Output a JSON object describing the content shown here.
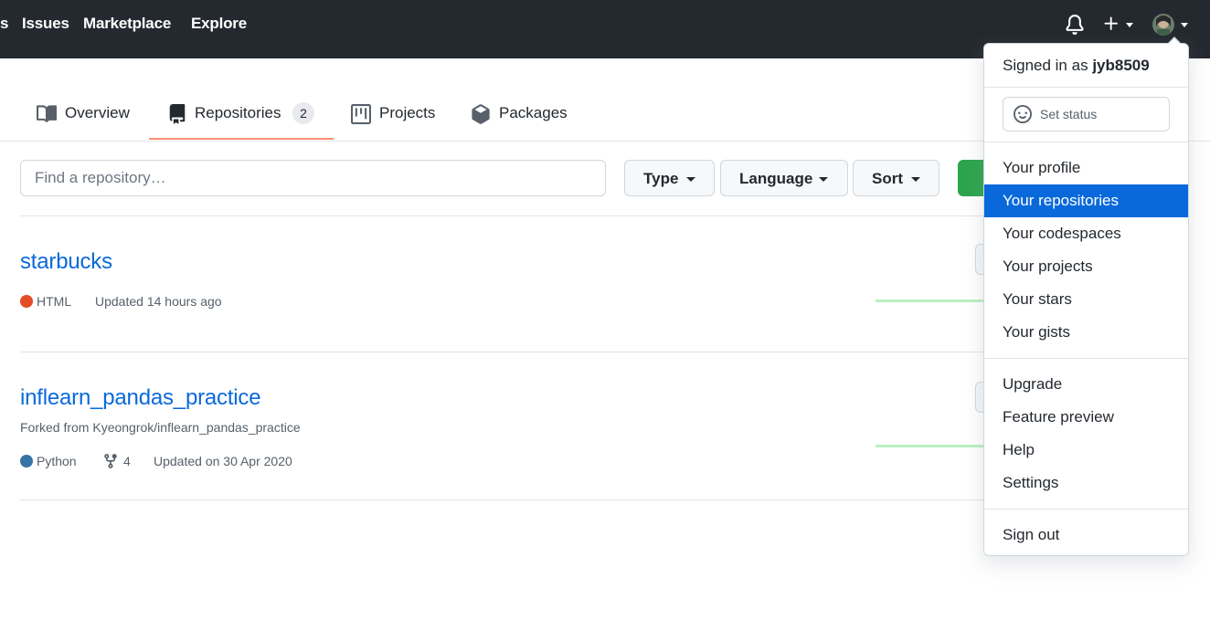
{
  "header": {
    "nav": [
      "s",
      "Issues",
      "Marketplace",
      "Explore"
    ],
    "icons": [
      "bell-icon",
      "plus-icon",
      "avatar"
    ]
  },
  "tabs": [
    {
      "label": "Overview",
      "icon": "book-icon"
    },
    {
      "label": "Repositories",
      "icon": "repo-icon",
      "count": "2",
      "active": true
    },
    {
      "label": "Projects",
      "icon": "project-icon"
    },
    {
      "label": "Packages",
      "icon": "package-icon"
    }
  ],
  "filters": {
    "search_placeholder": "Find a repository…",
    "type_label": "Type",
    "language_label": "Language",
    "sort_label": "Sort"
  },
  "repos": [
    {
      "name": "starbucks",
      "language": "HTML",
      "language_color": "#e34c26",
      "updated": "Updated 14 hours ago"
    },
    {
      "name": "inflearn_pandas_practice",
      "forked_from": "Forked from Kyeongrok/inflearn_pandas_practice",
      "language": "Python",
      "language_color": "#3572A5",
      "forks": "4",
      "updated": "Updated on 30 Apr 2020"
    }
  ],
  "user_menu": {
    "signed_in_prefix": "Signed in as",
    "username": "jyb8509",
    "set_status": "Set status",
    "group1": [
      "Your profile",
      "Your repositories",
      "Your codespaces",
      "Your projects",
      "Your stars",
      "Your gists"
    ],
    "group2": [
      "Upgrade",
      "Feature preview",
      "Help",
      "Settings"
    ],
    "sign_out": "Sign out",
    "selected_item": "Your repositories"
  },
  "colors": {
    "header_bg": "#24292f",
    "link": "#0969da",
    "selected_bg": "#0969da",
    "active_tab_underline": "#fd8c73",
    "new_button": "#2da44e"
  }
}
